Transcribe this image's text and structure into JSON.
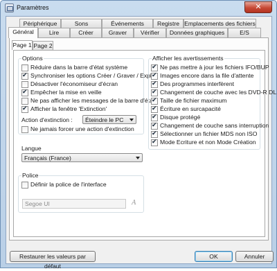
{
  "window": {
    "title": "Paramètres",
    "close_label": "✕"
  },
  "tabs_row1": [
    "Périphérique",
    "Sons",
    "Événements",
    "Registre",
    "Emplacements des fichiers"
  ],
  "tabs_row2": [
    "Général",
    "Lire",
    "Créer",
    "Graver",
    "Vérifier",
    "Données graphiques",
    "E/S"
  ],
  "active_tab": "Général",
  "subtabs": [
    "Page 1",
    "Page 2"
  ],
  "active_subtab": "Page 1",
  "options": {
    "title": "Options",
    "items": [
      {
        "label": "Réduire dans la barre d'état système",
        "checked": false
      },
      {
        "label": "Synchroniser les options Créer / Graver / Explor",
        "checked": true
      },
      {
        "label": "Désactiver l'économiseur d'écran",
        "checked": false
      },
      {
        "label": "Empêcher la mise en veille",
        "checked": true
      },
      {
        "label": "Ne pas afficher les messages de la barre d'état",
        "checked": false
      },
      {
        "label": "Afficher la fenêtre 'Extinction'",
        "checked": true
      }
    ],
    "shutdown_label": "Action d'extinction :",
    "shutdown_value": "Éteindre le PC",
    "force_label": "Ne jamais forcer une action d'extinction",
    "force_checked": false
  },
  "warnings": {
    "title": "Afficher les avertissements",
    "items": [
      {
        "label": "Ne pas mettre à jour les fichiers IFO/BUP",
        "checked": true
      },
      {
        "label": "Images encore dans la file d'attente",
        "checked": true
      },
      {
        "label": "Des programmes interfèrent",
        "checked": true
      },
      {
        "label": "Changement de couche avec les DVD-R DL",
        "checked": true
      },
      {
        "label": "Taille de fichier maximum",
        "checked": true
      },
      {
        "label": "Écriture en surcapacité",
        "checked": true
      },
      {
        "label": "Disque protégé",
        "checked": true
      },
      {
        "label": "Changement de couche sans interruption",
        "checked": true
      },
      {
        "label": "Sélectionner un fichier MDS non ISO",
        "checked": true
      },
      {
        "label": "Mode Ecriture et non Mode Création",
        "checked": true
      }
    ]
  },
  "language": {
    "title": "Langue",
    "value": "Français (France)"
  },
  "font": {
    "title": "Police",
    "define_label": "Définir la police de l'interface",
    "define_checked": false,
    "value": "Segoe UI",
    "button_icon": "font-icon"
  },
  "buttons": {
    "restore": "Restaurer les valeurs par défaut",
    "ok": "OK",
    "cancel": "Annuler"
  }
}
